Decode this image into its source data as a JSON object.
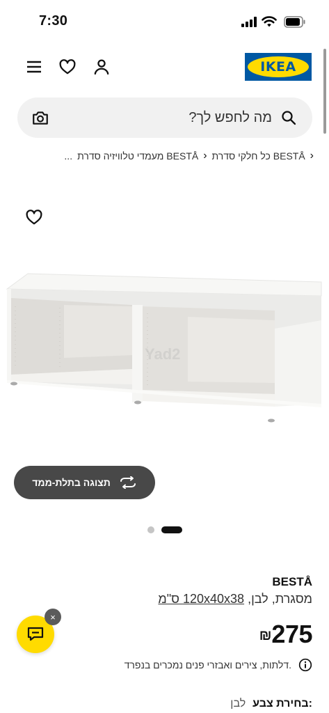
{
  "status_bar": {
    "time": "7:30"
  },
  "header": {
    "logo_text": "IKEA",
    "icons": [
      "menu-icon",
      "heart-icon",
      "user-icon"
    ]
  },
  "search": {
    "placeholder": "מה לחפש לך?"
  },
  "breadcrumb": {
    "items": [
      "כל חלקי סדרת BESTÅ",
      "מעמדי טלוויזיה סדרת BESTÅ",
      "..."
    ],
    "separator": "›"
  },
  "gallery": {
    "view_3d_label": "תצוגה בתלת-ממד",
    "watermark": "Yad2",
    "current_image": 2,
    "total_images": 2
  },
  "product": {
    "name": "BESTÅ",
    "description_prefix": "מסגרת, לבן,",
    "dimensions": "120x40x38 ס\"מ",
    "price_amount": "275",
    "currency": "₪",
    "note": "דלתות, צירים ואבזרי פנים נמכרים בנפרד."
  },
  "color_selection": {
    "label": "בחירת צבע:",
    "value": "לבן"
  },
  "chat": {
    "close_label": "×"
  },
  "colors": {
    "ikea_blue": "#0058a3",
    "ikea_yellow": "#ffdb00",
    "button_dark": "#484848",
    "search_bg": "#f1f1f1"
  }
}
